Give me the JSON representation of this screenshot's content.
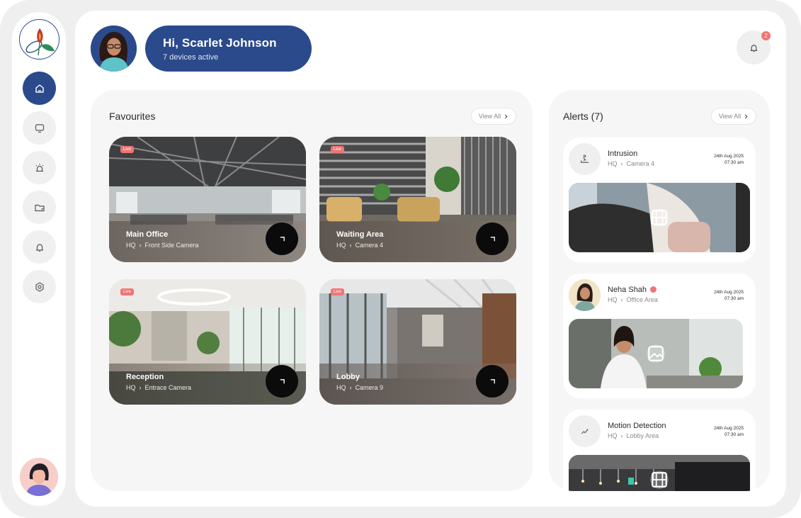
{
  "user": {
    "greeting": "Hi, Scarlet Johnson",
    "devices": "7 devices active"
  },
  "notifications": {
    "count": "2"
  },
  "sidebar": {
    "items": [
      {
        "icon": "home-icon",
        "active": true
      },
      {
        "icon": "monitor-icon",
        "active": false
      },
      {
        "icon": "siren-icon",
        "active": false
      },
      {
        "icon": "folder-heart-icon",
        "active": false
      },
      {
        "icon": "bell-icon",
        "active": false
      },
      {
        "icon": "settings-icon",
        "active": false
      }
    ]
  },
  "favourites": {
    "title": "Favourites",
    "view_all": "View All",
    "cameras": [
      {
        "live": "Live",
        "name": "Main Office",
        "site": "HQ",
        "camera": "Front Side Camera"
      },
      {
        "live": "Live",
        "name": "Waiting Area",
        "site": "HQ",
        "camera": "Camera 4"
      },
      {
        "live": "Live",
        "name": "Reception",
        "site": "HQ",
        "camera": "Entrace Camera"
      },
      {
        "live": "Live",
        "name": "Lobby",
        "site": "HQ",
        "camera": "Camera 9"
      }
    ]
  },
  "alerts": {
    "title": "Alerts (7)",
    "view_all": "View All",
    "items": [
      {
        "title": "Intrusion",
        "site": "HQ",
        "camera": "Camera 4",
        "date": "24th Aug 2025",
        "time": "07:30 am"
      },
      {
        "title": "Neha Shah",
        "site": "HQ",
        "camera": "Office Area",
        "date": "24th Aug 2025",
        "time": "07:30 am"
      },
      {
        "title": "Motion Detection",
        "site": "HQ",
        "camera": "Lobby Area",
        "date": "24th Aug 2025",
        "time": "07:30 am"
      }
    ]
  },
  "colors": {
    "brand": "#2b4a8b",
    "live": "#f07474",
    "panel": "#f6f6f6",
    "frame": "#efefef"
  }
}
